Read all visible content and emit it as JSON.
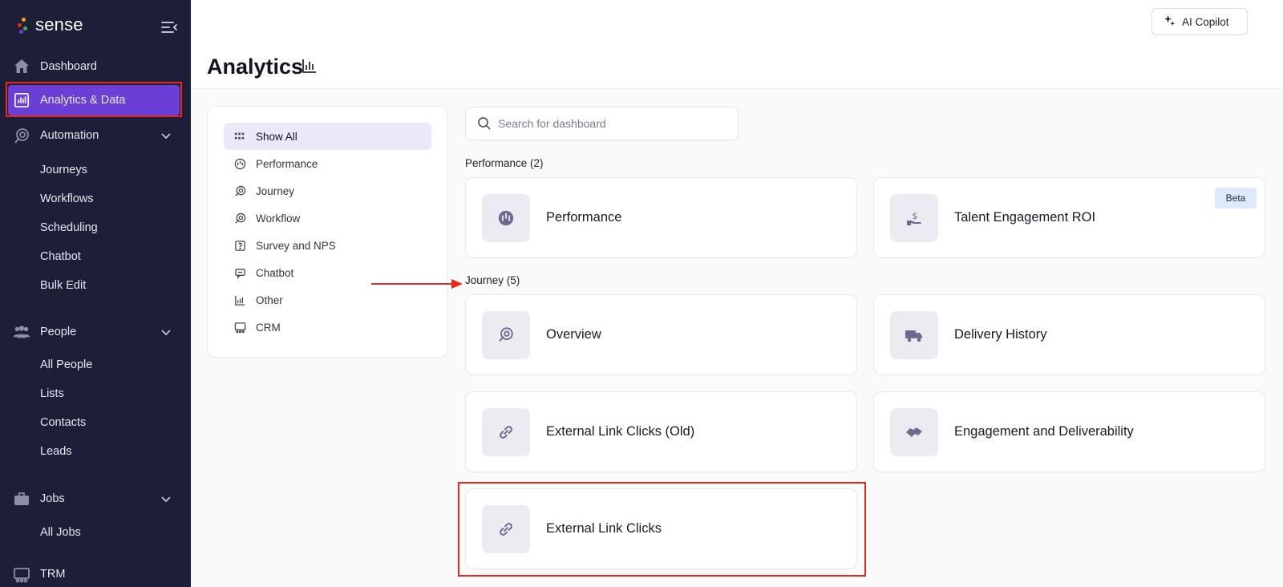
{
  "brand": {
    "name": "sense",
    "dot_colors": [
      "#f5a623",
      "#e8271d",
      "#4caf50",
      "#6a3fd6"
    ]
  },
  "sidebar": {
    "nav": [
      {
        "label": "Dashboard",
        "icon": "home-icon"
      },
      {
        "label": "Analytics & Data",
        "icon": "bar-chart-icon",
        "active": true
      },
      {
        "label": "Automation",
        "icon": "automation-icon",
        "expanded": true
      },
      {
        "label": "People",
        "icon": "people-icon",
        "expanded": true
      },
      {
        "label": "Jobs",
        "icon": "briefcase-icon",
        "expanded": true
      },
      {
        "label": "TRM",
        "icon": "trm-icon"
      }
    ],
    "automation_items": [
      "Journeys",
      "Workflows",
      "Scheduling",
      "Chatbot",
      "Bulk Edit"
    ],
    "people_items": [
      "All People",
      "Lists",
      "Contacts",
      "Leads"
    ],
    "jobs_items": [
      "All Jobs"
    ]
  },
  "header": {
    "title": "Analytics",
    "copilot_label": "AI Copilot"
  },
  "filters": [
    {
      "label": "Show All",
      "icon": "grid-icon",
      "selected": true
    },
    {
      "label": "Performance",
      "icon": "gauge-icon"
    },
    {
      "label": "Journey",
      "icon": "journey-icon"
    },
    {
      "label": "Workflow",
      "icon": "workflow-icon"
    },
    {
      "label": "Survey and NPS",
      "icon": "survey-icon"
    },
    {
      "label": "Chatbot",
      "icon": "chatbot-icon"
    },
    {
      "label": "Other",
      "icon": "chart-icon"
    },
    {
      "label": "CRM",
      "icon": "crm-icon"
    }
  ],
  "search": {
    "placeholder": "Search for dashboard",
    "value": ""
  },
  "sections": [
    {
      "title": "Performance (2)",
      "cards": [
        {
          "label": "Performance",
          "icon": "gauge-icon"
        },
        {
          "label": "Talent Engagement ROI",
          "icon": "hand-dollar-icon",
          "badge": "Beta"
        }
      ]
    },
    {
      "title": "Journey (5)",
      "cards": [
        {
          "label": "Overview",
          "icon": "journey-icon"
        },
        {
          "label": "Delivery History",
          "icon": "truck-icon"
        },
        {
          "label": "External Link Clicks (Old)",
          "icon": "link-icon"
        },
        {
          "label": "Engagement and Deliverability",
          "icon": "handshake-icon"
        },
        {
          "label": "External Link Clicks",
          "icon": "link-icon"
        }
      ]
    }
  ],
  "colors": {
    "sidebar_bg": "#1c1f37",
    "accent": "#6a3fd6",
    "highlight": "#e8271d",
    "filter_selected_bg": "#ebe8f8",
    "beta_bg": "#dde9fa"
  }
}
